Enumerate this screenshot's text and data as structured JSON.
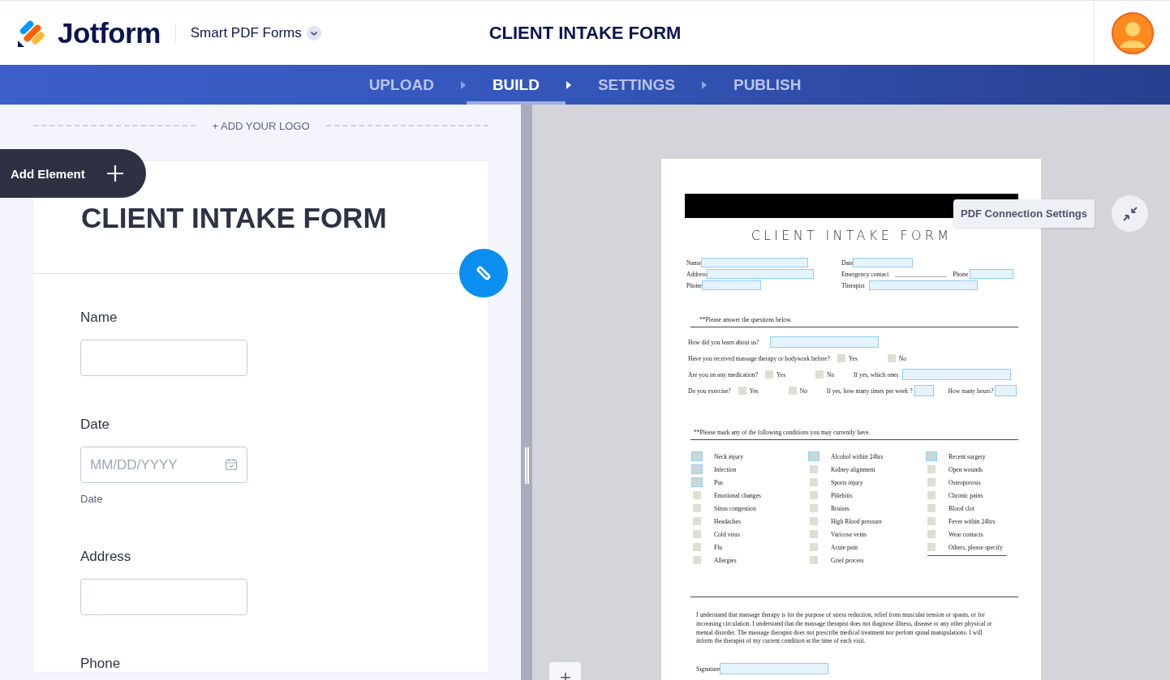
{
  "header": {
    "logo_text": "Jotform",
    "product": "Smart PDF Forms",
    "form_title": "CLIENT INTAKE FORM"
  },
  "steps": [
    {
      "label": "UPLOAD",
      "selected": false
    },
    {
      "label": "BUILD",
      "selected": true
    },
    {
      "label": "SETTINGS",
      "selected": false
    },
    {
      "label": "PUBLISH",
      "selected": false
    }
  ],
  "builder": {
    "add_logo": "+ ADD YOUR LOGO",
    "add_element": "Add Element",
    "form_title": "CLIENT INTAKE FORM",
    "fields": [
      {
        "kind": "text",
        "label": "Name"
      },
      {
        "kind": "date",
        "label": "Date",
        "placeholder": "MM/DD/YYYY",
        "sublabel": "Date"
      },
      {
        "kind": "text",
        "label": "Address"
      },
      {
        "kind": "label",
        "label": "Phone"
      }
    ]
  },
  "preview": {
    "tooltip": "PDF Connection Settings",
    "document": {
      "title": "CLIENT INTAKE FORM",
      "info_rows": [
        {
          "left": "Name",
          "right": "Date"
        },
        {
          "left": "Address",
          "right": "Emergency contact",
          "right_extra": "Phone"
        },
        {
          "left": "Phone",
          "right": "Therapist"
        }
      ],
      "section_1": "**Please answer the questions below.",
      "questions": [
        {
          "kind": "field",
          "text": "How did you learn about us?"
        },
        {
          "kind": "choice",
          "text": "Have you received massage therapy or bodywork before?",
          "options": [
            {
              "label": "Yes",
              "mapped": false
            },
            {
              "label": "No",
              "mapped": false
            }
          ]
        },
        {
          "kind": "choice",
          "text": "Are you on any medication?",
          "options": [
            {
              "label": "Yes",
              "mapped": false
            },
            {
              "label": "No",
              "mapped": false
            }
          ],
          "followups": [
            "If yes, which ones"
          ]
        },
        {
          "kind": "choice",
          "text": "Do you exercise?",
          "options": [
            {
              "label": "Yes",
              "mapped": false
            },
            {
              "label": "No",
              "mapped": false
            }
          ],
          "followups": [
            "If yes, how many times per week ?",
            "How many hours?"
          ]
        }
      ],
      "section_2": "**Please mark any of the following conditions you may currently have.",
      "condition_columns": [
        {
          "items": [
            {
              "text": "Neck injury",
              "mapped": true
            },
            {
              "text": "Infection",
              "mapped": true
            },
            {
              "text": "Pus",
              "mapped": true
            },
            {
              "text": "Emotional changes",
              "mapped": false
            },
            {
              "text": "Sinus congestion",
              "mapped": false
            },
            {
              "text": "Headaches",
              "mapped": false
            },
            {
              "text": "Cold virus",
              "mapped": false
            },
            {
              "text": "Flu",
              "mapped": false
            },
            {
              "text": "Allergies",
              "mapped": false
            }
          ]
        },
        {
          "items": [
            {
              "text": "Alcohol within 24hrs",
              "mapped": true
            },
            {
              "text": "Kidney alignment",
              "mapped": false
            },
            {
              "text": "Sports injury",
              "mapped": false
            },
            {
              "text": "Phlebitis",
              "mapped": false
            },
            {
              "text": "Bruises",
              "mapped": false
            },
            {
              "text": "High Blood pressure",
              "mapped": false
            },
            {
              "text": "Varicose veins",
              "mapped": false
            },
            {
              "text": "Acute pain",
              "mapped": false
            },
            {
              "text": "Grief process",
              "mapped": false
            }
          ]
        },
        {
          "items": [
            {
              "text": "Recent surgery",
              "mapped": true
            },
            {
              "text": "Open wounds",
              "mapped": false
            },
            {
              "text": "Osteoporosis",
              "mapped": false
            },
            {
              "text": "Chronic pains",
              "mapped": false
            },
            {
              "text": "Blood clot",
              "mapped": false
            },
            {
              "text": "Fever within 24hrs",
              "mapped": false
            },
            {
              "text": "Wear contacts",
              "mapped": false
            },
            {
              "text": "Others, please specify",
              "mapped": false
            }
          ]
        }
      ],
      "consent": "I understand that massage therapy is for the purpose of stress reduction, relief from muscular tension or spasm, or for increasing circulation. I understand that the massage therapist does not diagnose illness, disease or any other physical or mental disorder. The massage therapist does not prescribe medical treatment nor perfom spinal manipulations. I will inform the therapist of my current condition at the time of each visit.",
      "signature": "Signature"
    }
  }
}
